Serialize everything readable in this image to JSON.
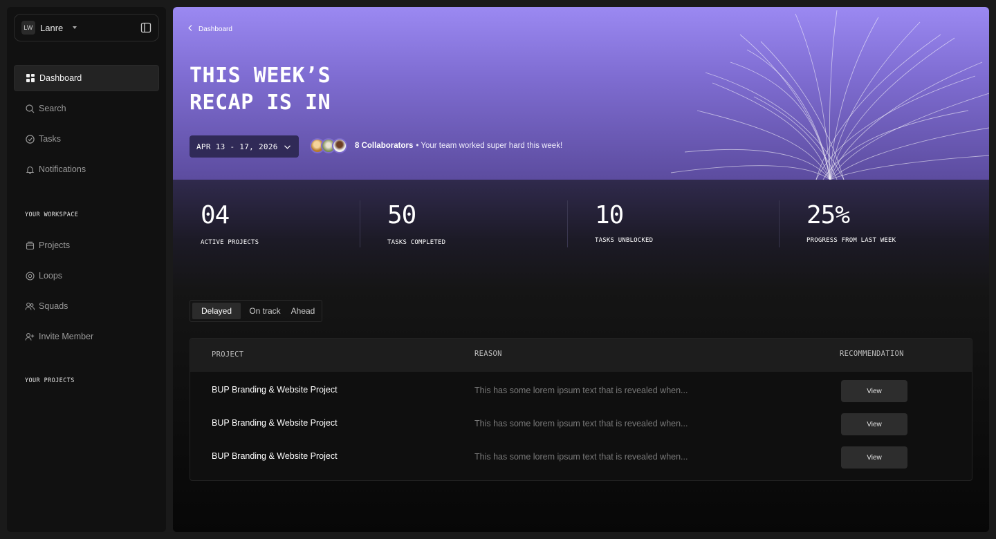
{
  "user": {
    "initials": "LW",
    "name": "Lanre"
  },
  "nav": {
    "items": [
      {
        "label": "Dashboard",
        "icon": "grid-icon",
        "active": true
      },
      {
        "label": "Search",
        "icon": "search-icon"
      },
      {
        "label": "Tasks",
        "icon": "check-circle-icon"
      },
      {
        "label": "Notifications",
        "icon": "bell-icon"
      }
    ],
    "workspace_label": "YOUR WORKSPACE",
    "workspace_items": [
      {
        "label": "Projects",
        "icon": "stack-icon"
      },
      {
        "label": "Loops",
        "icon": "loop-icon"
      },
      {
        "label": "Squads",
        "icon": "users-icon"
      },
      {
        "label": "Invite Member",
        "icon": "user-plus-icon"
      }
    ],
    "projects_label": "YOUR PROJECTS"
  },
  "header": {
    "breadcrumb": "Dashboard",
    "title": "THIS WEEK’S\nRECAP IS IN",
    "date_range": "APR 13 - 17, 2026",
    "collaborators": "8 Collaborators",
    "collab_message": "• Your team worked super hard this week!"
  },
  "stats": [
    {
      "value": "04",
      "label": "ACTIVE PROJECTS"
    },
    {
      "value": "50",
      "label": "TASKS COMPLETED"
    },
    {
      "value": "10",
      "label": "TASKS UNBLOCKED"
    },
    {
      "value": "25%",
      "label": "PROGRESS FROM LAST WEEK"
    }
  ],
  "filters": {
    "tabs": [
      "Delayed",
      "On track",
      "Ahead"
    ],
    "selected": "Delayed"
  },
  "table": {
    "columns": [
      "PROJECT",
      "REASON",
      "RECOMMENDATION"
    ],
    "rows": [
      {
        "project": "BUP Branding & Website Project",
        "reason": "This has some lorem ipsum text that is revealed when...",
        "action": "View"
      },
      {
        "project": "BUP Branding & Website Project",
        "reason": "This has some lorem ipsum text that is revealed when...",
        "action": "View"
      },
      {
        "project": "BUP Branding & Website Project",
        "reason": "This has some lorem ipsum text that is revealed when...",
        "action": "View"
      }
    ]
  },
  "colors": {
    "hero_top": "#9b89f2",
    "hero_bottom": "#5c4c9f",
    "background": "#1a1a1a",
    "sidebar": "#111111"
  }
}
